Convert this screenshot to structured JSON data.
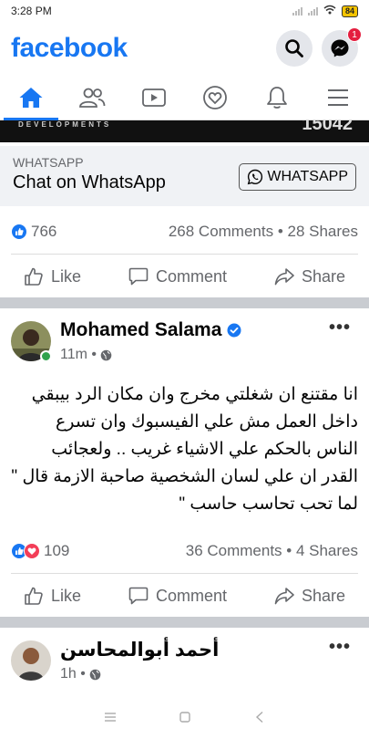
{
  "status_bar": {
    "time": "3:28 PM",
    "battery": "84"
  },
  "header": {
    "logo": "facebook",
    "messenger_badge": "1"
  },
  "ad": {
    "banner_text": "DEVELOPMENTS",
    "banner_number": "15042",
    "cta_small": "WHATSAPP",
    "cta_title": "Chat on WhatsApp",
    "cta_button": "WHATSAPP",
    "reactions_count": "766",
    "engagement": "268 Comments • 28 Shares"
  },
  "actions": {
    "like": "Like",
    "comment": "Comment",
    "share": "Share"
  },
  "post1": {
    "author": "Mohamed Salama",
    "time": "11m •",
    "text": "انا مقتنع ان شغلتي مخرج وان مكان الرد بيبقي داخل العمل مش علي الفيسبوك وان تسرع الناس بالحكم علي الاشياء غريب .. ولعجائب القدر ان علي لسان الشخصية صاحبة الازمة قال \" لما تحب تحاسب حاسب \"",
    "reactions_count": "109",
    "engagement": "36 Comments • 4 Shares"
  },
  "post2": {
    "author": "أحمد أبوالمحاسن",
    "time": "1h •"
  },
  "colors": {
    "brand": "#1877f2",
    "love": "#f33e58",
    "online": "#31a24c"
  }
}
